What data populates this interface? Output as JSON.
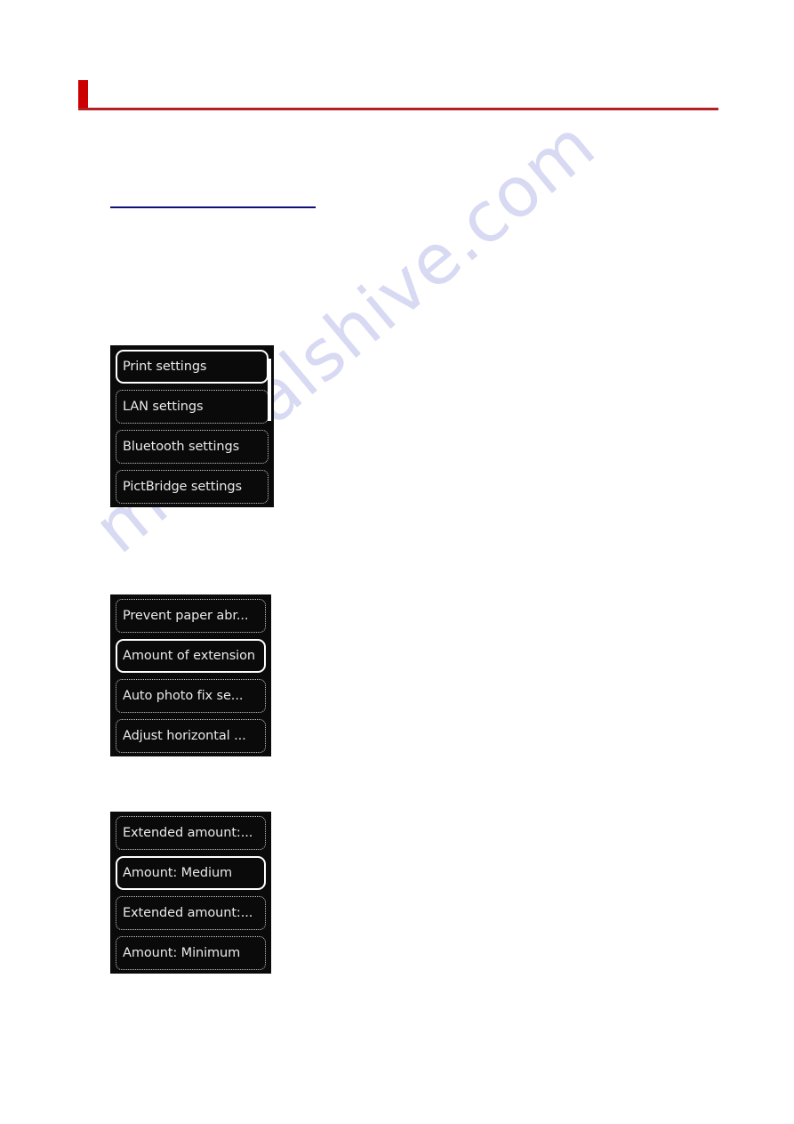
{
  "document": {
    "title": "",
    "paragraphs": {
      "intro": "",
      "step_1": "",
      "step_2": "",
      "step_3": "",
      "step_4": "",
      "step_5": "",
      "step_6": "",
      "step_7": ""
    },
    "link": {
      "label": ""
    }
  },
  "watermark": {
    "text": "manualshive.com",
    "color": "#d8d9f2"
  },
  "colors": {
    "accent_bar": "#cc0000",
    "header_rule": "#b52025",
    "link_underline": "#10107a",
    "lcd_background": "#0a0a0a",
    "lcd_text": "#e9e9e9",
    "selection_ring": "#ff1a1a",
    "selection_border": "#ffffff"
  },
  "screens": [
    {
      "name": "setup-menu",
      "has_scrollbar": true,
      "items": [
        {
          "label": "Print settings",
          "selected": true,
          "ringed": true
        },
        {
          "label": "LAN settings",
          "selected": false,
          "ringed": false
        },
        {
          "label": "Bluetooth settings",
          "selected": false,
          "ringed": false
        },
        {
          "label": "PictBridge settings",
          "selected": false,
          "ringed": false
        }
      ]
    },
    {
      "name": "print-settings-menu",
      "has_scrollbar": false,
      "items": [
        {
          "label": "Prevent paper abr...",
          "selected": false,
          "ringed": false
        },
        {
          "label": "Amount of extension",
          "selected": true,
          "ringed": true
        },
        {
          "label": "Auto photo fix se...",
          "selected": false,
          "ringed": false
        },
        {
          "label": "Adjust horizontal ...",
          "selected": false,
          "ringed": false
        }
      ]
    },
    {
      "name": "amount-of-extension-menu",
      "has_scrollbar": false,
      "items": [
        {
          "label": "Extended amount:...",
          "selected": false,
          "ringed": false
        },
        {
          "label": "Amount: Medium",
          "selected": true,
          "ringed": false
        },
        {
          "label": "Extended amount:...",
          "selected": false,
          "ringed": false
        },
        {
          "label": "Amount: Minimum",
          "selected": false,
          "ringed": false
        }
      ]
    }
  ]
}
